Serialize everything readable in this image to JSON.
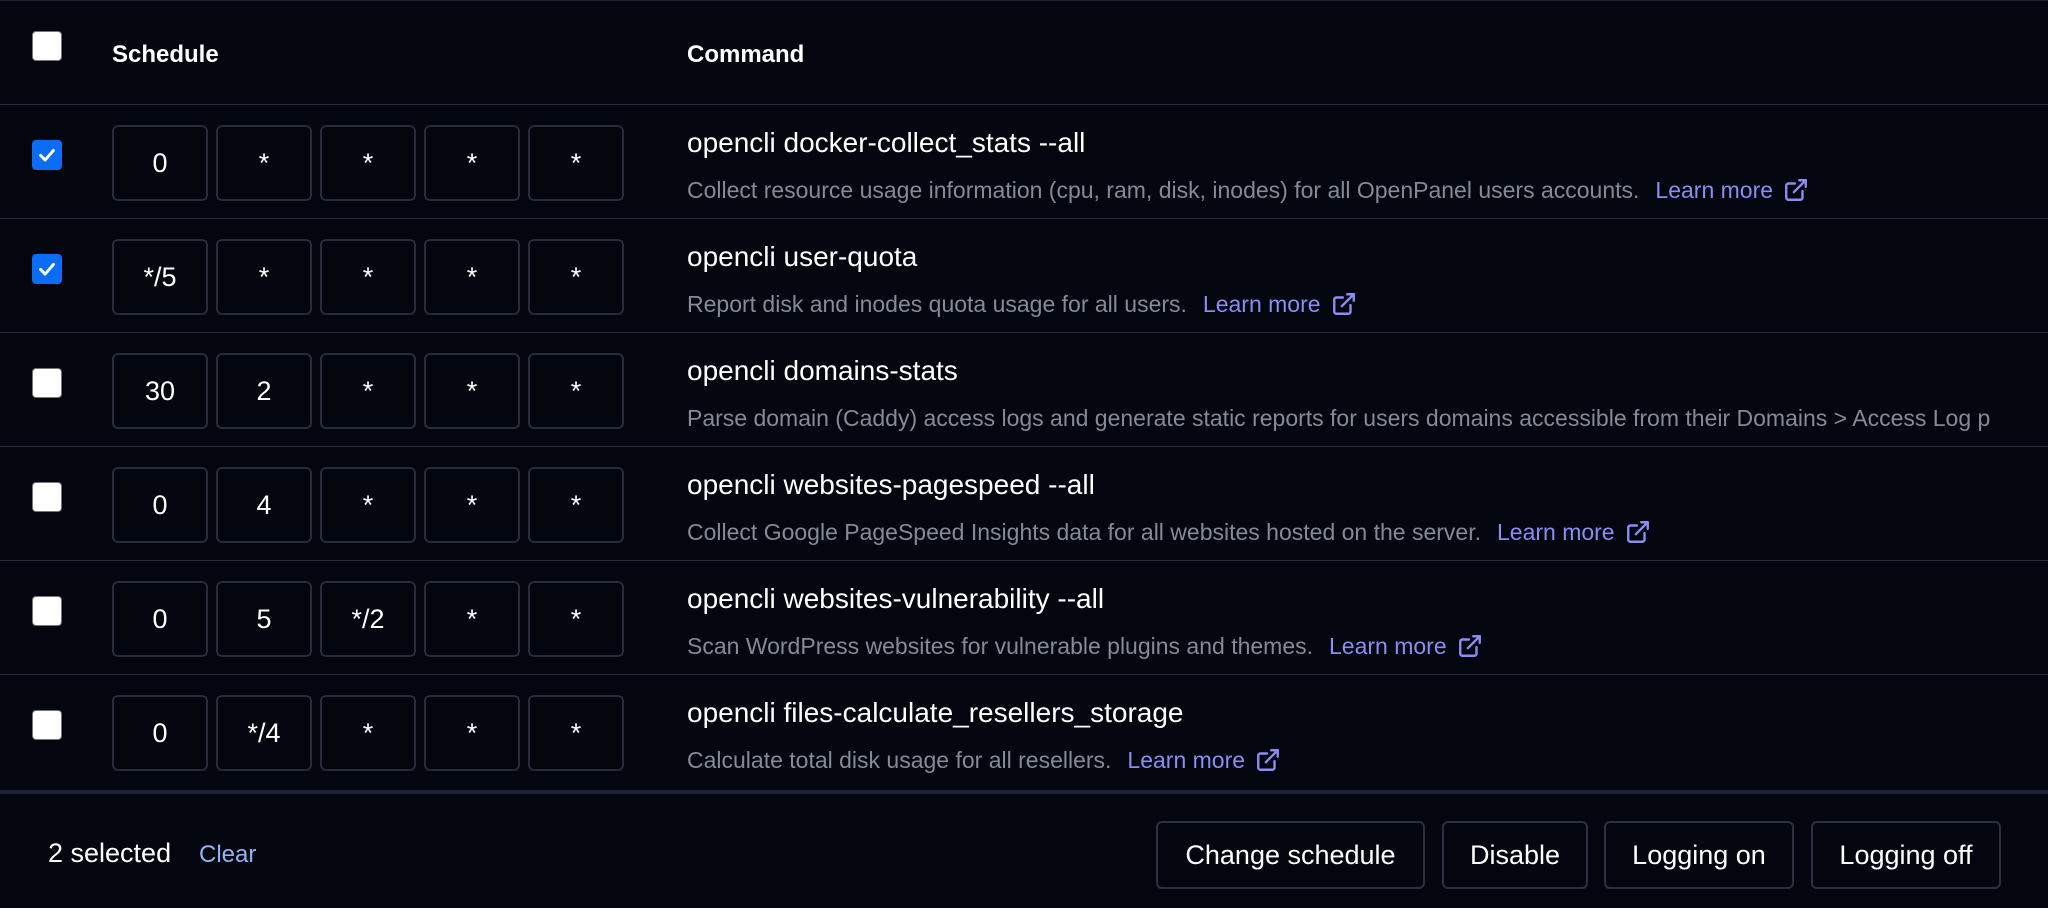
{
  "header": {
    "schedule_label": "Schedule",
    "command_label": "Command"
  },
  "rows": [
    {
      "checked": true,
      "cron": [
        "0",
        "*",
        "*",
        "*",
        "*"
      ],
      "command": "opencli docker-collect_stats --all",
      "description": "Collect resource usage information (cpu, ram, disk, inodes) for all OpenPanel users accounts.",
      "learn_more": "Learn more"
    },
    {
      "checked": true,
      "cron": [
        "*/5",
        "*",
        "*",
        "*",
        "*"
      ],
      "command": "opencli user-quota",
      "description": "Report disk and inodes quota usage for all users.",
      "learn_more": "Learn more"
    },
    {
      "checked": false,
      "cron": [
        "30",
        "2",
        "*",
        "*",
        "*"
      ],
      "command": "opencli domains-stats",
      "description": "Parse domain (Caddy) access logs and generate static reports for users domains accessible from their Domains > Access Log p",
      "learn_more": ""
    },
    {
      "checked": false,
      "cron": [
        "0",
        "4",
        "*",
        "*",
        "*"
      ],
      "command": "opencli websites-pagespeed --all",
      "description": "Collect Google PageSpeed Insights data for all websites hosted on the server.",
      "learn_more": "Learn more"
    },
    {
      "checked": false,
      "cron": [
        "0",
        "5",
        "*/2",
        "*",
        "*"
      ],
      "command": "opencli websites-vulnerability --all",
      "description": "Scan WordPress websites for vulnerable plugins and themes.",
      "learn_more": "Learn more"
    },
    {
      "checked": false,
      "cron": [
        "0",
        "*/4",
        "*",
        "*",
        "*"
      ],
      "command": "opencli files-calculate_resellers_storage",
      "description": "Calculate total disk usage for all resellers.",
      "learn_more": "Learn more"
    }
  ],
  "footer": {
    "selected_text": "2 selected",
    "clear_label": "Clear",
    "buttons": [
      "Change schedule",
      "Disable",
      "Logging on",
      "Logging off"
    ]
  },
  "colors": {
    "background": "#03060f",
    "accent_checkbox": "#0b6df6",
    "link": "#8b8df2",
    "muted_text": "#858a96"
  },
  "icons": {
    "checkbox_check": "check-icon",
    "learn_more": "external-link-icon"
  }
}
